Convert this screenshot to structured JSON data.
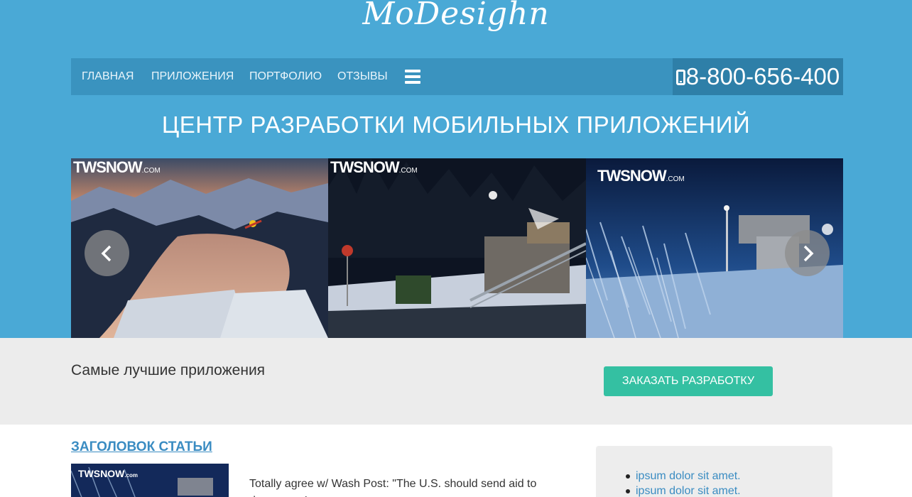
{
  "site": {
    "logo": "MoDesighn"
  },
  "nav": {
    "items": [
      {
        "label": "ГЛАВНАЯ"
      },
      {
        "label": "ПРИЛОЖЕНИЯ"
      },
      {
        "label": "ПОРТФОЛИО"
      },
      {
        "label": "ОТЗЫВЫ"
      }
    ],
    "menu_icon": "hamburger-icon",
    "phone": "8-800-656-400",
    "phone_icon": "mobile-phone-icon"
  },
  "hero": {
    "title": "ЦЕНТР РАЗРАБОТКИ МОБИЛЬНЫХ ПРИЛОЖЕНИЙ"
  },
  "slider": {
    "slides": [
      {
        "brand": "TWSNOW",
        "brand_suffix": ".COM"
      },
      {
        "brand": "TWSNOW",
        "brand_suffix": ".COM"
      },
      {
        "brand": "TWSNOW",
        "brand_suffix": ".COM"
      }
    ],
    "prev_icon": "chevron-left-icon",
    "next_icon": "chevron-right-icon"
  },
  "promo": {
    "text": "Самые лучшие приложения",
    "button_label": "ЗАКАЗАТЬ РАЗРАБОТКУ"
  },
  "article": {
    "title": "ЗАГОЛОВОК СТАТЬИ",
    "thumb_brand": "TWSNOW",
    "thumb_brand_suffix": ".com",
    "text": "Totally agree w/ Wash Post: \"The U.S. should send aid to democracy's"
  },
  "sidebar": {
    "items": [
      {
        "label": "ipsum dolor sit amet."
      },
      {
        "label": "ipsum dolor sit amet."
      }
    ]
  },
  "colors": {
    "header_bg": "#4aa9d6",
    "nav_bg": "#3a93bf",
    "phone_bg": "#2e7fa8",
    "accent_button": "#34c0a2",
    "link": "#3a8cc2"
  }
}
